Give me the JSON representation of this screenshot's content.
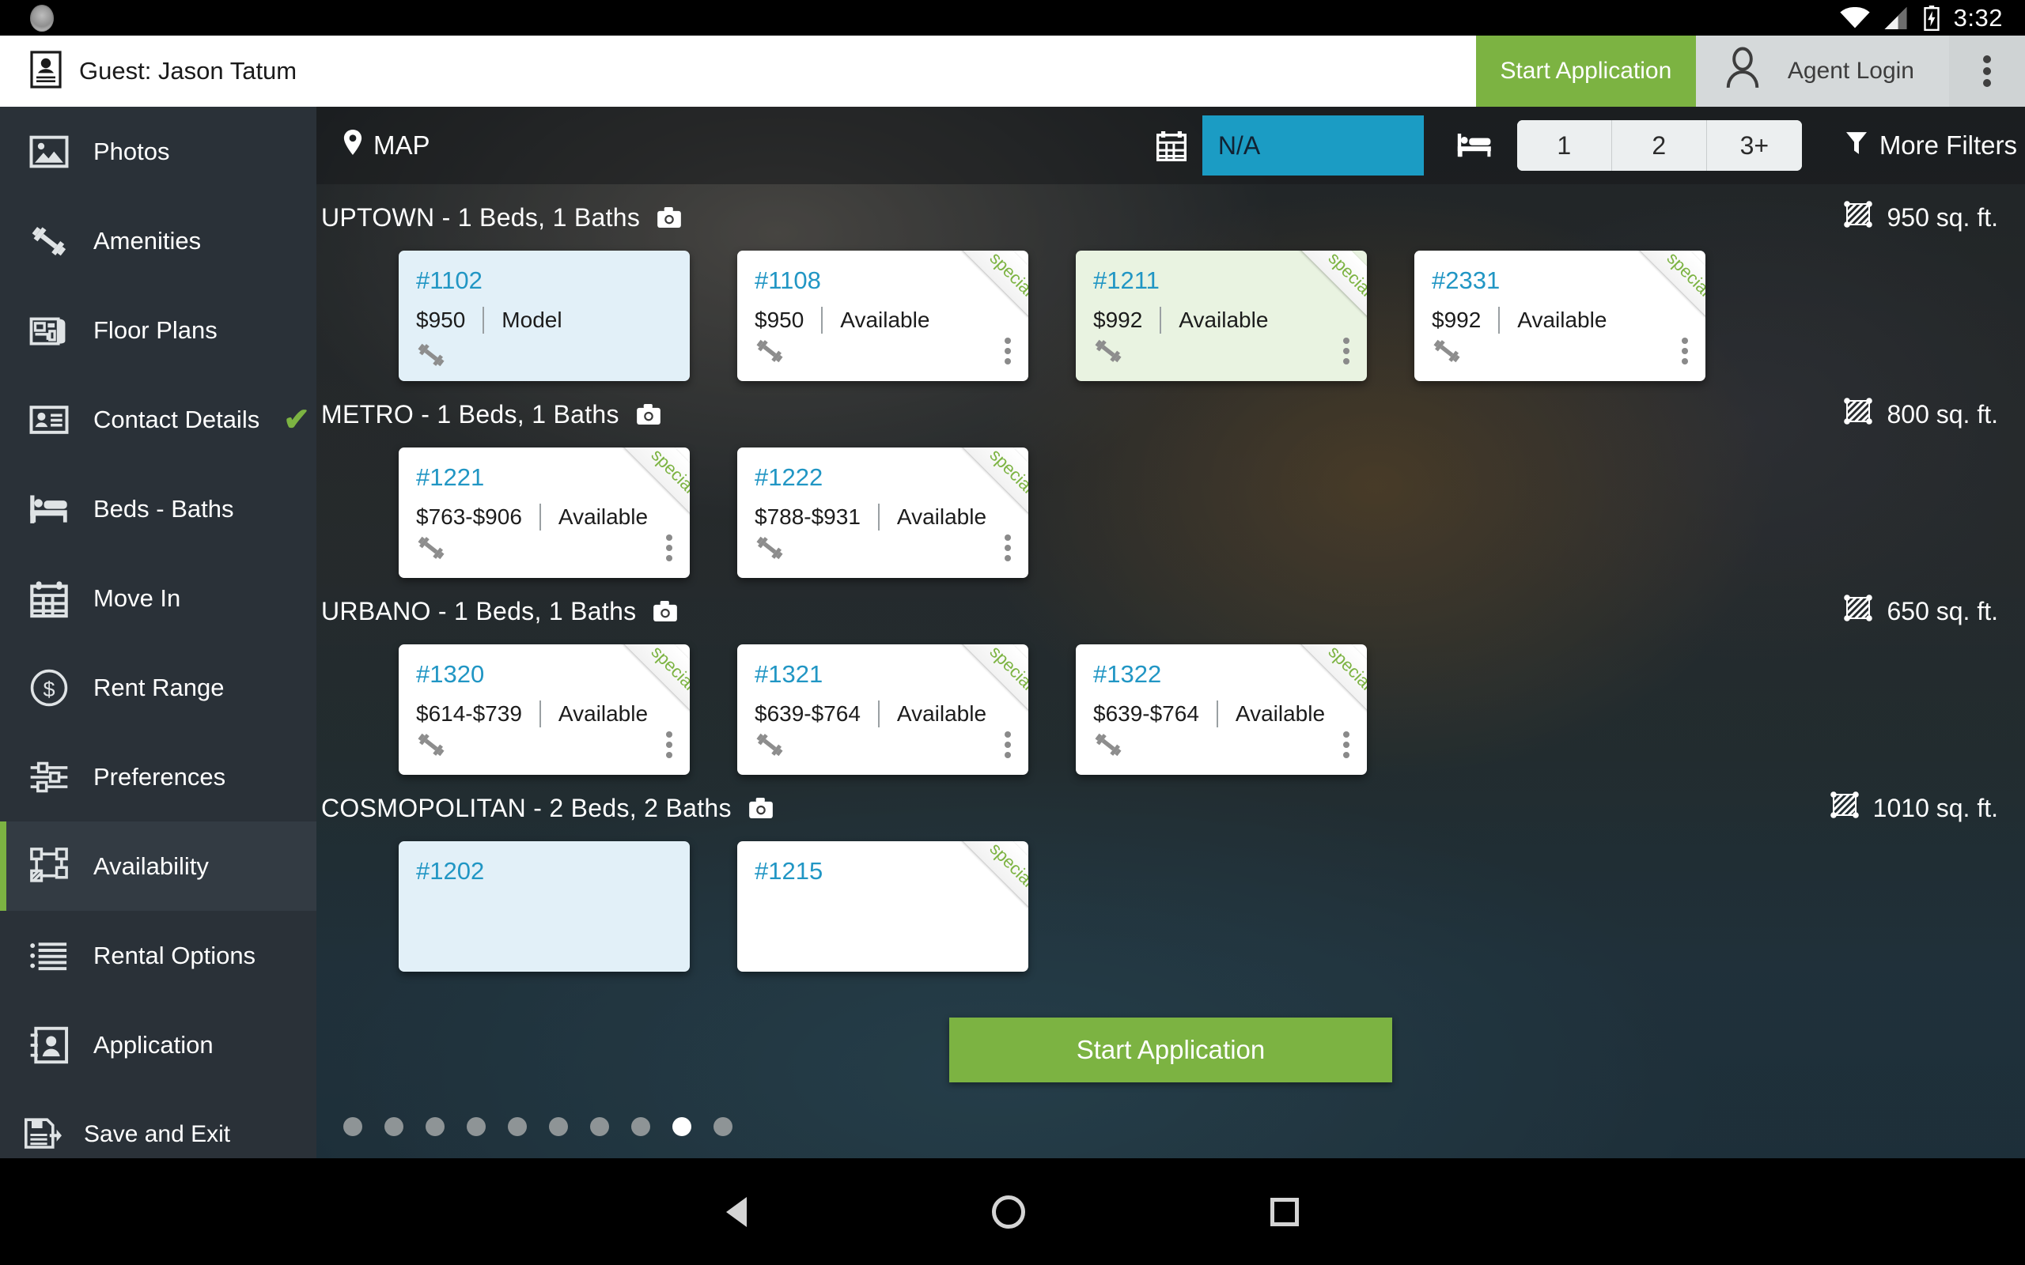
{
  "statusbar": {
    "time": "3:32",
    "wifi_icon": "wifi-icon",
    "signal_icon": "cell-signal-icon",
    "battery_icon": "battery-charging-icon"
  },
  "appbar": {
    "guest_label": "Guest: Jason Tatum",
    "guest_icon": "contact-card-icon",
    "start_application_label": "Start Application",
    "agent_login_label": "Agent Login",
    "agent_icon": "person-icon",
    "overflow_icon": "kebab-menu-icon",
    "accent_green": "#7cb342"
  },
  "sidebar": {
    "items": [
      {
        "label": "Photos",
        "icon": "photo-icon",
        "active": false,
        "checked": false
      },
      {
        "label": "Amenities",
        "icon": "dumbbell-icon",
        "active": false,
        "checked": false
      },
      {
        "label": "Floor Plans",
        "icon": "blueprint-icon",
        "active": false,
        "checked": false
      },
      {
        "label": "Contact Details",
        "icon": "contact-card-icon",
        "active": false,
        "checked": true
      },
      {
        "label": "Beds - Baths",
        "icon": "bed-icon",
        "active": false,
        "checked": false
      },
      {
        "label": "Move In",
        "icon": "calendar-icon",
        "active": false,
        "checked": false
      },
      {
        "label": "Rent Range",
        "icon": "dollar-circle-icon",
        "active": false,
        "checked": false
      },
      {
        "label": "Preferences",
        "icon": "sliders-icon",
        "active": false,
        "checked": false
      },
      {
        "label": "Availability",
        "icon": "sitemap-icon",
        "active": true,
        "checked": false
      },
      {
        "label": "Rental Options",
        "icon": "list-icon",
        "active": false,
        "checked": false
      },
      {
        "label": "Application",
        "icon": "address-book-icon",
        "active": false,
        "checked": false
      },
      {
        "label": "Save and Exit",
        "icon": "save-exit-icon",
        "active": false,
        "checked": false
      }
    ],
    "check_mark": "✔"
  },
  "filterbar": {
    "map_label": "MAP",
    "map_icon": "map-pin-icon",
    "calendar_icon": "calendar-icon",
    "move_in_value": "N/A",
    "move_in_placeholder": "N/A",
    "bed_icon": "bed-icon",
    "bed_options": [
      "1",
      "2",
      "3+"
    ],
    "more_filters_label": "More Filters",
    "filter_icon": "funnel-icon",
    "move_in_field_color": "#1b9cc4"
  },
  "groups": [
    {
      "name": "UPTOWN - 1 Beds, 1 Baths",
      "camera_icon": "camera-icon",
      "sqft": "950 sq. ft.",
      "sqft_icon": "area-icon",
      "units": [
        {
          "number": "#1102",
          "price": "$950",
          "status": "Model",
          "tint": "blue",
          "specials": false,
          "menu": false
        },
        {
          "number": "#1108",
          "price": "$950",
          "status": "Available",
          "tint": "white",
          "specials": true,
          "menu": true
        },
        {
          "number": "#1211",
          "price": "$992",
          "status": "Available",
          "tint": "green",
          "specials": true,
          "menu": true
        },
        {
          "number": "#2331",
          "price": "$992",
          "status": "Available",
          "tint": "white",
          "specials": true,
          "menu": true
        }
      ]
    },
    {
      "name": "METRO - 1 Beds, 1 Baths",
      "camera_icon": "camera-icon",
      "sqft": "800 sq. ft.",
      "sqft_icon": "area-icon",
      "units": [
        {
          "number": "#1221",
          "price": "$763-$906",
          "status": "Available",
          "tint": "white",
          "specials": true,
          "menu": true
        },
        {
          "number": "#1222",
          "price": "$788-$931",
          "status": "Available",
          "tint": "white",
          "specials": true,
          "menu": true
        }
      ]
    },
    {
      "name": "URBANO - 1 Beds, 1 Baths",
      "camera_icon": "camera-icon",
      "sqft": "650 sq. ft.",
      "sqft_icon": "area-icon",
      "units": [
        {
          "number": "#1320",
          "price": "$614-$739",
          "status": "Available",
          "tint": "white",
          "specials": true,
          "menu": true
        },
        {
          "number": "#1321",
          "price": "$639-$764",
          "status": "Available",
          "tint": "white",
          "specials": true,
          "menu": true
        },
        {
          "number": "#1322",
          "price": "$639-$764",
          "status": "Available",
          "tint": "white",
          "specials": true,
          "menu": true
        }
      ]
    },
    {
      "name": "COSMOPOLITAN - 2 Beds, 2 Baths",
      "camera_icon": "camera-icon",
      "sqft": "1010 sq. ft.",
      "sqft_icon": "area-icon",
      "units": [
        {
          "number": "#1202",
          "price": "",
          "status": "",
          "tint": "blue",
          "specials": false,
          "menu": false
        },
        {
          "number": "#1215",
          "price": "",
          "status": "",
          "tint": "white",
          "specials": true,
          "menu": false
        }
      ]
    }
  ],
  "specials_ribbon_label": "specials",
  "cta": {
    "label": "Start Application",
    "color": "#7cb342"
  },
  "pagination": {
    "total": 10,
    "active_index": 8
  },
  "navbar": {
    "back_icon": "back-triangle-icon",
    "home_icon": "home-circle-icon",
    "recents_icon": "recents-square-icon"
  }
}
